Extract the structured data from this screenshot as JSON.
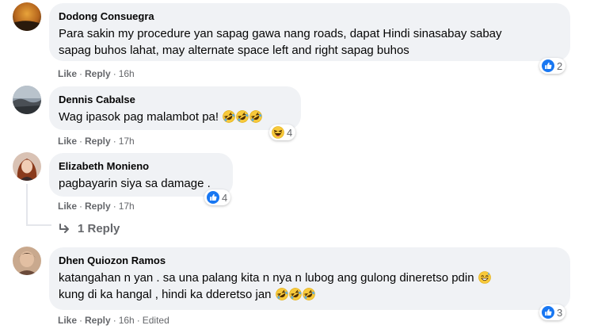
{
  "actions": {
    "like": "Like",
    "reply": "Reply",
    "dot": "·"
  },
  "comments": [
    {
      "author": "Dodong Consuegra",
      "lines": [
        "Para sakin my procedure yan sapag gawa nang roads, dapat Hindi sinasabay sabay",
        "sapag buhos lahat, may alternate space left and right sapag buhos"
      ],
      "time": "16h",
      "reaction_count": "2",
      "reaction_type": "like"
    },
    {
      "author": "Dennis Cabalse",
      "lines": [
        "Wag ipasok pag malambot pa!"
      ],
      "time": "17h",
      "reaction_count": "4",
      "reaction_type": "haha"
    },
    {
      "author": "Elizabeth Monieno",
      "lines": [
        "pagbayarin siya sa damage ."
      ],
      "time": "17h",
      "reaction_count": "4",
      "reaction_type": "like"
    },
    {
      "author": "Dhen Quiozon Ramos",
      "lines": [
        "katangahan n yan . sa una palang kita n nya n lubog ang gulong dineretso pdin",
        "kung di ka hangal , hindi ka dderetso jan"
      ],
      "time": "16h",
      "edited": "Edited",
      "reaction_count": "3",
      "reaction_type": "like"
    }
  ],
  "replies_link": "1 Reply",
  "colors": {
    "bubble": "#f0f2f5",
    "like_blue": "#1877f2",
    "meta": "#65676b",
    "text": "#050505"
  }
}
